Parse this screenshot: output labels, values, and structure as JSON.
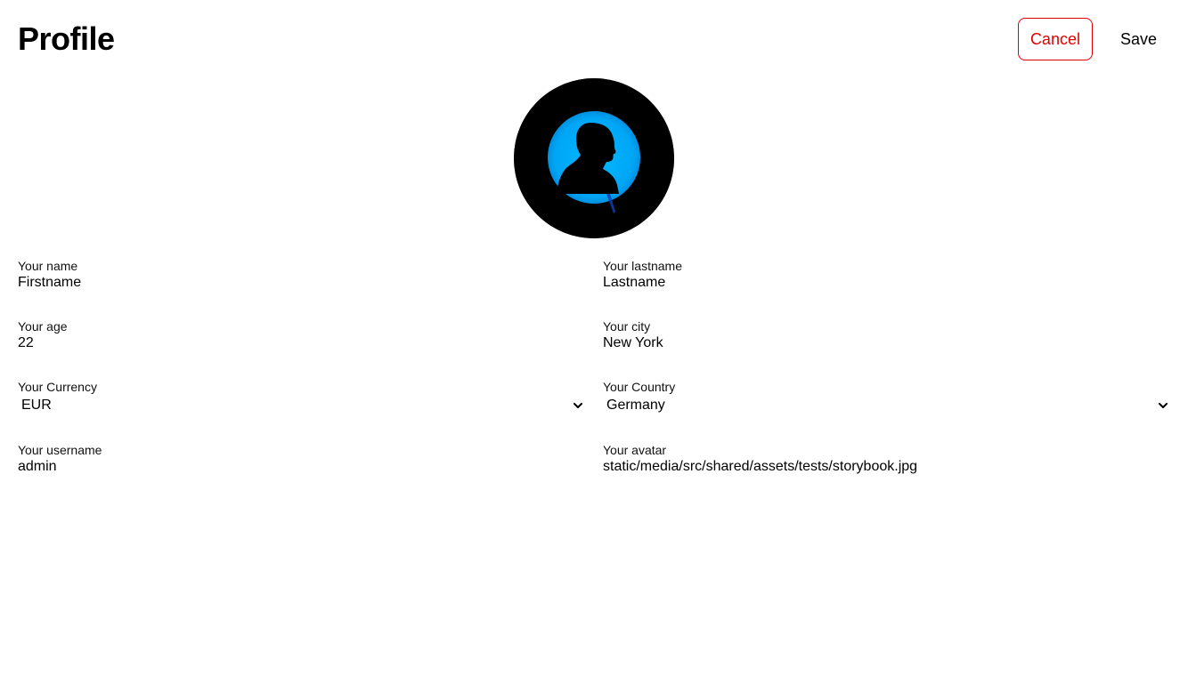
{
  "header": {
    "title": "Profile",
    "cancel_label": "Cancel",
    "save_label": "Save"
  },
  "colors": {
    "cancel": "#e00000",
    "avatar_bg": "#000000",
    "avatar_glow": "#00aaff"
  },
  "avatar": {
    "icon": "person-silhouette-avatar"
  },
  "form": {
    "name": {
      "label": "Your name",
      "value": "Firstname"
    },
    "lastname": {
      "label": "Your lastname",
      "value": "Lastname"
    },
    "age": {
      "label": "Your age",
      "value": "22"
    },
    "city": {
      "label": "Your city",
      "value": "New York"
    },
    "currency": {
      "label": "Your Currency",
      "value": "EUR"
    },
    "country": {
      "label": "Your Country",
      "value": "Germany"
    },
    "username": {
      "label": "Your username",
      "value": "admin"
    },
    "avatar": {
      "label": "Your avatar",
      "value": "static/media/src/shared/assets/tests/storybook.jpg"
    }
  }
}
